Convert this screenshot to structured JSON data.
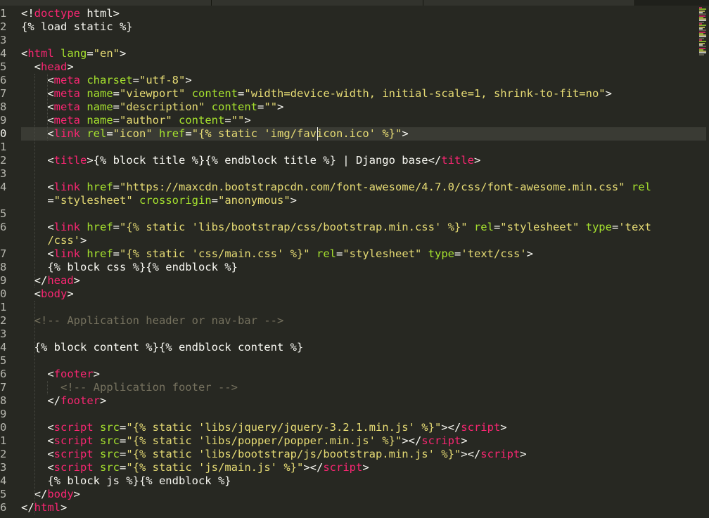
{
  "editor": {
    "syntax_colors": {
      "punct": "#f8f8f2",
      "tag": "#f92672",
      "attr": "#a6e22e",
      "string": "#e6db74",
      "comment": "#75715e",
      "background": "#272822",
      "active_line": "#3a3b34"
    },
    "active_line_number": "0",
    "gutter": [
      "1",
      "2",
      "3",
      "4",
      "5",
      "6",
      "7",
      "8",
      "9",
      "0",
      "1",
      "2",
      "3",
      "4",
      "",
      "5",
      "6",
      "",
      "7",
      "8",
      "9",
      "0",
      "1",
      "2",
      "3",
      "4",
      "5",
      "6",
      "7",
      "8",
      "9",
      "0",
      "1",
      "2",
      "3",
      "4",
      "5",
      "6"
    ],
    "code_lines": [
      {
        "segments": [
          {
            "t": "p",
            "s": "<!"
          },
          {
            "t": "tag",
            "s": "doctype"
          },
          {
            "t": "p",
            "s": " html>"
          }
        ]
      },
      {
        "segments": [
          {
            "t": "p",
            "s": "{% load static %}"
          }
        ]
      },
      {
        "segments": []
      },
      {
        "segments": [
          {
            "t": "p",
            "s": "<"
          },
          {
            "t": "tag",
            "s": "html"
          },
          {
            "t": "p",
            "s": " "
          },
          {
            "t": "attr",
            "s": "lang"
          },
          {
            "t": "p",
            "s": "="
          },
          {
            "t": "str",
            "s": "\"en\""
          },
          {
            "t": "p",
            "s": ">"
          }
        ]
      },
      {
        "segments": [
          {
            "t": "p",
            "s": "  <"
          },
          {
            "t": "tag",
            "s": "head"
          },
          {
            "t": "p",
            "s": ">"
          }
        ]
      },
      {
        "segments": [
          {
            "t": "p",
            "s": "    <"
          },
          {
            "t": "tag",
            "s": "meta"
          },
          {
            "t": "p",
            "s": " "
          },
          {
            "t": "attr",
            "s": "charset"
          },
          {
            "t": "p",
            "s": "="
          },
          {
            "t": "str",
            "s": "\"utf-8\""
          },
          {
            "t": "p",
            "s": ">"
          }
        ]
      },
      {
        "segments": [
          {
            "t": "p",
            "s": "    <"
          },
          {
            "t": "tag",
            "s": "meta"
          },
          {
            "t": "p",
            "s": " "
          },
          {
            "t": "attr",
            "s": "name"
          },
          {
            "t": "p",
            "s": "="
          },
          {
            "t": "str",
            "s": "\"viewport\""
          },
          {
            "t": "p",
            "s": " "
          },
          {
            "t": "attr",
            "s": "content"
          },
          {
            "t": "p",
            "s": "="
          },
          {
            "t": "str",
            "s": "\"width=device-width, initial-scale=1, shrink-to-fit=no\""
          },
          {
            "t": "p",
            "s": ">"
          }
        ]
      },
      {
        "segments": [
          {
            "t": "p",
            "s": "    <"
          },
          {
            "t": "tag",
            "s": "meta"
          },
          {
            "t": "p",
            "s": " "
          },
          {
            "t": "attr",
            "s": "name"
          },
          {
            "t": "p",
            "s": "="
          },
          {
            "t": "str",
            "s": "\"description\""
          },
          {
            "t": "p",
            "s": " "
          },
          {
            "t": "attr",
            "s": "content"
          },
          {
            "t": "p",
            "s": "="
          },
          {
            "t": "str",
            "s": "\"\""
          },
          {
            "t": "p",
            "s": ">"
          }
        ]
      },
      {
        "segments": [
          {
            "t": "p",
            "s": "    <"
          },
          {
            "t": "tag",
            "s": "meta"
          },
          {
            "t": "p",
            "s": " "
          },
          {
            "t": "attr",
            "s": "name"
          },
          {
            "t": "p",
            "s": "="
          },
          {
            "t": "str",
            "s": "\"author\""
          },
          {
            "t": "p",
            "s": " "
          },
          {
            "t": "attr",
            "s": "content"
          },
          {
            "t": "p",
            "s": "="
          },
          {
            "t": "str",
            "s": "\"\""
          },
          {
            "t": "p",
            "s": ">"
          }
        ]
      },
      {
        "segments": [
          {
            "t": "p",
            "s": "    <"
          },
          {
            "t": "tag",
            "s": "link"
          },
          {
            "t": "p",
            "s": " "
          },
          {
            "t": "attr",
            "s": "rel"
          },
          {
            "t": "p",
            "s": "="
          },
          {
            "t": "str",
            "s": "\"icon\""
          },
          {
            "t": "p",
            "s": " "
          },
          {
            "t": "attr",
            "s": "href"
          },
          {
            "t": "p",
            "s": "="
          },
          {
            "t": "str",
            "s": "\"{% static 'img/favicon.ico' %}\""
          },
          {
            "t": "p",
            "s": ">"
          }
        ]
      },
      {
        "segments": []
      },
      {
        "segments": [
          {
            "t": "p",
            "s": "    <"
          },
          {
            "t": "tag",
            "s": "title"
          },
          {
            "t": "p",
            "s": ">{% block title %}{% endblock title %} | Django base</"
          },
          {
            "t": "tag",
            "s": "title"
          },
          {
            "t": "p",
            "s": ">"
          }
        ]
      },
      {
        "segments": []
      },
      {
        "segments": [
          {
            "t": "p",
            "s": "    <"
          },
          {
            "t": "tag",
            "s": "link"
          },
          {
            "t": "p",
            "s": " "
          },
          {
            "t": "attr",
            "s": "href"
          },
          {
            "t": "p",
            "s": "="
          },
          {
            "t": "str",
            "s": "\"https://maxcdn.bootstrapcdn.com/font-awesome/4.7.0/css/font-awesome.min.css\""
          },
          {
            "t": "p",
            "s": " "
          },
          {
            "t": "attr",
            "s": "rel"
          }
        ]
      },
      {
        "segments": [
          {
            "t": "p",
            "s": "    ="
          },
          {
            "t": "str",
            "s": "\"stylesheet\""
          },
          {
            "t": "p",
            "s": " "
          },
          {
            "t": "attr",
            "s": "crossorigin"
          },
          {
            "t": "p",
            "s": "="
          },
          {
            "t": "str",
            "s": "\"anonymous\""
          },
          {
            "t": "p",
            "s": ">"
          }
        ]
      },
      {
        "segments": []
      },
      {
        "segments": [
          {
            "t": "p",
            "s": "    <"
          },
          {
            "t": "tag",
            "s": "link"
          },
          {
            "t": "p",
            "s": " "
          },
          {
            "t": "attr",
            "s": "href"
          },
          {
            "t": "p",
            "s": "="
          },
          {
            "t": "str",
            "s": "\"{% static 'libs/bootstrap/css/bootstrap.min.css' %}\""
          },
          {
            "t": "p",
            "s": " "
          },
          {
            "t": "attr",
            "s": "rel"
          },
          {
            "t": "p",
            "s": "="
          },
          {
            "t": "str",
            "s": "\"stylesheet\""
          },
          {
            "t": "p",
            "s": " "
          },
          {
            "t": "attr",
            "s": "type"
          },
          {
            "t": "p",
            "s": "="
          },
          {
            "t": "str",
            "s": "'text"
          }
        ]
      },
      {
        "segments": [
          {
            "t": "str",
            "s": "    /css'"
          },
          {
            "t": "p",
            "s": ">"
          }
        ]
      },
      {
        "segments": [
          {
            "t": "p",
            "s": "    <"
          },
          {
            "t": "tag",
            "s": "link"
          },
          {
            "t": "p",
            "s": " "
          },
          {
            "t": "attr",
            "s": "href"
          },
          {
            "t": "p",
            "s": "="
          },
          {
            "t": "str",
            "s": "\"{% static 'css/main.css' %}\""
          },
          {
            "t": "p",
            "s": " "
          },
          {
            "t": "attr",
            "s": "rel"
          },
          {
            "t": "p",
            "s": "="
          },
          {
            "t": "str",
            "s": "\"stylesheet\""
          },
          {
            "t": "p",
            "s": " "
          },
          {
            "t": "attr",
            "s": "type"
          },
          {
            "t": "p",
            "s": "="
          },
          {
            "t": "str",
            "s": "'text/css'"
          },
          {
            "t": "p",
            "s": ">"
          }
        ]
      },
      {
        "segments": [
          {
            "t": "p",
            "s": "    {% block css %}{% endblock %}"
          }
        ]
      },
      {
        "segments": [
          {
            "t": "p",
            "s": "  </"
          },
          {
            "t": "tag",
            "s": "head"
          },
          {
            "t": "p",
            "s": ">"
          }
        ]
      },
      {
        "segments": [
          {
            "t": "p",
            "s": "  <"
          },
          {
            "t": "tag",
            "s": "body"
          },
          {
            "t": "p",
            "s": ">"
          }
        ]
      },
      {
        "segments": []
      },
      {
        "segments": [
          {
            "t": "cmt",
            "s": "  <!-- Application header or nav-bar -->"
          }
        ]
      },
      {
        "segments": []
      },
      {
        "segments": [
          {
            "t": "p",
            "s": "  {% block content %}{% endblock content %}"
          }
        ]
      },
      {
        "segments": []
      },
      {
        "segments": [
          {
            "t": "p",
            "s": "    <"
          },
          {
            "t": "tag",
            "s": "footer"
          },
          {
            "t": "p",
            "s": ">"
          }
        ]
      },
      {
        "segments": [
          {
            "t": "cmt",
            "s": "      <!-- Application footer -->"
          }
        ]
      },
      {
        "segments": [
          {
            "t": "p",
            "s": "    </"
          },
          {
            "t": "tag",
            "s": "footer"
          },
          {
            "t": "p",
            "s": ">"
          }
        ]
      },
      {
        "segments": []
      },
      {
        "segments": [
          {
            "t": "p",
            "s": "    <"
          },
          {
            "t": "tag",
            "s": "script"
          },
          {
            "t": "p",
            "s": " "
          },
          {
            "t": "attr",
            "s": "src"
          },
          {
            "t": "p",
            "s": "="
          },
          {
            "t": "str",
            "s": "\"{% static 'libs/jquery/jquery-3.2.1.min.js' %}\""
          },
          {
            "t": "p",
            "s": "></"
          },
          {
            "t": "tag",
            "s": "script"
          },
          {
            "t": "p",
            "s": ">"
          }
        ]
      },
      {
        "segments": [
          {
            "t": "p",
            "s": "    <"
          },
          {
            "t": "tag",
            "s": "script"
          },
          {
            "t": "p",
            "s": " "
          },
          {
            "t": "attr",
            "s": "src"
          },
          {
            "t": "p",
            "s": "="
          },
          {
            "t": "str",
            "s": "\"{% static 'libs/popper/popper.min.js' %}\""
          },
          {
            "t": "p",
            "s": "></"
          },
          {
            "t": "tag",
            "s": "script"
          },
          {
            "t": "p",
            "s": ">"
          }
        ]
      },
      {
        "segments": [
          {
            "t": "p",
            "s": "    <"
          },
          {
            "t": "tag",
            "s": "script"
          },
          {
            "t": "p",
            "s": " "
          },
          {
            "t": "attr",
            "s": "src"
          },
          {
            "t": "p",
            "s": "="
          },
          {
            "t": "str",
            "s": "\"{% static 'libs/bootstrap/js/bootstrap.min.js' %}\""
          },
          {
            "t": "p",
            "s": "></"
          },
          {
            "t": "tag",
            "s": "script"
          },
          {
            "t": "p",
            "s": ">"
          }
        ]
      },
      {
        "segments": [
          {
            "t": "p",
            "s": "    <"
          },
          {
            "t": "tag",
            "s": "script"
          },
          {
            "t": "p",
            "s": " "
          },
          {
            "t": "attr",
            "s": "src"
          },
          {
            "t": "p",
            "s": "="
          },
          {
            "t": "str",
            "s": "\"{% static 'js/main.js' %}\""
          },
          {
            "t": "p",
            "s": "></"
          },
          {
            "t": "tag",
            "s": "script"
          },
          {
            "t": "p",
            "s": ">"
          }
        ]
      },
      {
        "segments": [
          {
            "t": "p",
            "s": "    {% block js %}{% endblock %}"
          }
        ]
      },
      {
        "segments": [
          {
            "t": "p",
            "s": "  </"
          },
          {
            "t": "tag",
            "s": "body"
          },
          {
            "t": "p",
            "s": ">"
          }
        ]
      },
      {
        "segments": [
          {
            "t": "p",
            "s": "</"
          },
          {
            "t": "tag",
            "s": "html"
          },
          {
            "t": "p",
            "s": ">"
          }
        ]
      }
    ]
  }
}
